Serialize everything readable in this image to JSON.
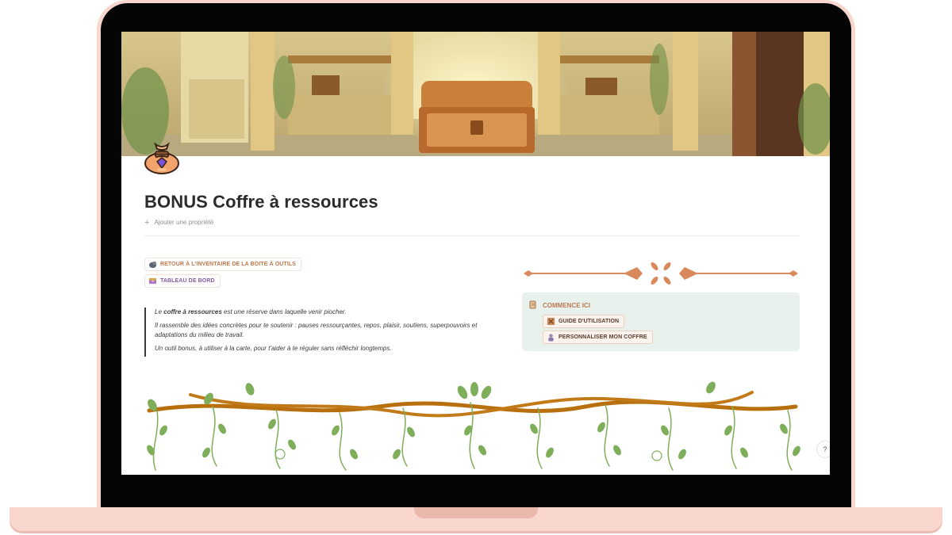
{
  "page": {
    "title": "BONUS Coffre à ressources",
    "add_property": "Ajouter une propriété"
  },
  "links": {
    "back": "RETOUR À L'INVENTAIRE DE LA BOITE À OUTILS",
    "dashboard": "TABLEAU DE BORD"
  },
  "quote": {
    "line1_prefix": "Le ",
    "line1_bold": "coffre à ressources",
    "line1_suffix": " est une réserve dans laquelle venir piocher.",
    "line2": "Il rassemble des idées concrètes pour te soutenir : pauses ressourçantes, repos, plaisir, soutiens, superpouvoirs et adaptations du milieu de travail.",
    "line3": "Un outil bonus, à utiliser à la carte, pour t'aider à te réguler sans réfléchir longtemps."
  },
  "callout": {
    "title": "COMMENCE ICI",
    "items": [
      {
        "label": "GUIDE D'UTILISATION"
      },
      {
        "label": "PERSONNALISER MON COFFRE"
      }
    ]
  },
  "icons": {
    "page_icon": "money-bag-icon",
    "back_link": "bird-icon",
    "dashboard_link": "treasure-icon",
    "callout": "scroll-icon",
    "guide": "map-icon",
    "customize": "character-icon"
  },
  "colors": {
    "frame": "#f9d7cf",
    "accent_orange": "#c1784b",
    "accent_purple": "#8a5aa6",
    "callout_bg": "#e9f1ec",
    "callout_title": "#b97a4e",
    "vine_branch": "#b8700f",
    "leaf_green": "#7fae5a"
  }
}
